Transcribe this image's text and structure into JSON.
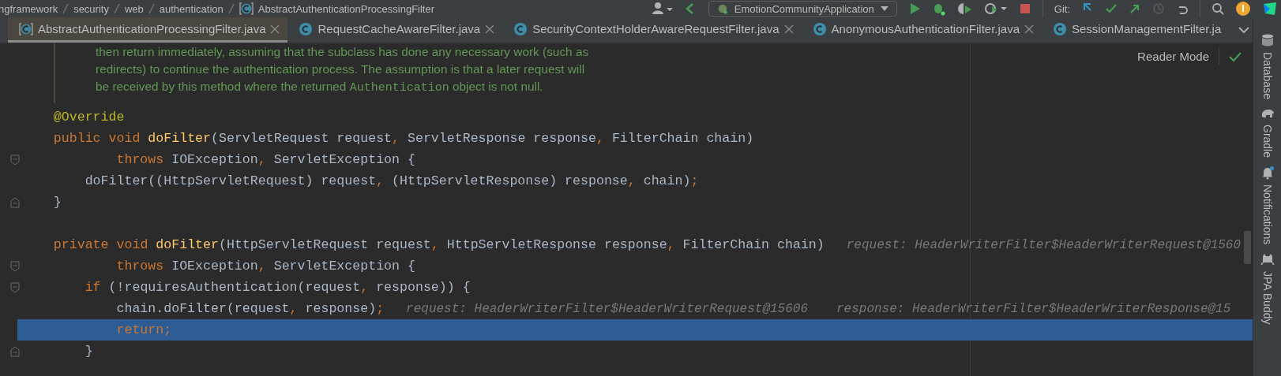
{
  "toolbar": {
    "breadcrumbs": [
      {
        "label": "ngframework",
        "kind": "package"
      },
      {
        "label": "security",
        "kind": "package"
      },
      {
        "label": "web",
        "kind": "package"
      },
      {
        "label": "authentication",
        "kind": "package"
      },
      {
        "label": "AbstractAuthenticationProcessingFilter",
        "kind": "class"
      }
    ],
    "run_config": "EmotionCommunityApplication",
    "git_label": "Git:"
  },
  "tabs": [
    {
      "label": "AbstractAuthenticationProcessingFilter.java",
      "kind": "abstract",
      "selected": true,
      "closable": true
    },
    {
      "label": "RequestCacheAwareFilter.java",
      "kind": "class",
      "selected": false,
      "closable": true
    },
    {
      "label": "SecurityContextHolderAwareRequestFilter.java",
      "kind": "class",
      "selected": false,
      "closable": true
    },
    {
      "label": "AnonymousAuthenticationFilter.java",
      "kind": "class",
      "selected": false,
      "closable": true
    },
    {
      "label": "SessionManagementFilter.ja",
      "kind": "class",
      "selected": false,
      "closable": false
    }
  ],
  "reader_mode": "Reader Mode",
  "doc_comment": [
    [
      {
        "text": "then return immediately, assuming that the subclass has done any necessary work (such as",
        "code": false
      }
    ],
    [
      {
        "text": "redirects) to continue the authentication process. The assumption is that a later request will",
        "code": false
      }
    ],
    [
      {
        "text": "be received by this method where the returned ",
        "code": false
      },
      {
        "text": "Authentication",
        "code": true
      },
      {
        "text": " object is not null.",
        "code": false
      }
    ]
  ],
  "code_lines": [
    {
      "kind": "code",
      "fold_open": false,
      "fold_close": false,
      "current": false,
      "tokens": [
        {
          "text": "    @Override",
          "kind": "ann"
        }
      ]
    },
    {
      "kind": "code",
      "fold_open": false,
      "fold_close": false,
      "current": false,
      "tokens": [
        {
          "text": "    public",
          "kind": "kw"
        },
        {
          "text": " void",
          "kind": "kw"
        },
        {
          "text": " doFilter",
          "kind": "fn"
        },
        {
          "text": "(ServletRequest request",
          "kind": "plain"
        },
        {
          "text": ",",
          "kind": "punc"
        },
        {
          "text": " ServletResponse response",
          "kind": "plain"
        },
        {
          "text": ",",
          "kind": "punc"
        },
        {
          "text": " FilterChain chain)",
          "kind": "plain"
        }
      ]
    },
    {
      "kind": "code",
      "fold_open": true,
      "fold_close": false,
      "current": false,
      "tokens": [
        {
          "text": "            throws",
          "kind": "kw"
        },
        {
          "text": " IOException",
          "kind": "plain"
        },
        {
          "text": ",",
          "kind": "punc"
        },
        {
          "text": " ServletException {",
          "kind": "plain"
        }
      ]
    },
    {
      "kind": "code",
      "fold_open": false,
      "fold_close": false,
      "current": false,
      "tokens": [
        {
          "text": "        doFilter((HttpServletRequest) request",
          "kind": "plain"
        },
        {
          "text": ",",
          "kind": "punc"
        },
        {
          "text": " (HttpServletResponse) response",
          "kind": "plain"
        },
        {
          "text": ",",
          "kind": "punc"
        },
        {
          "text": " chain)",
          "kind": "plain"
        },
        {
          "text": ";",
          "kind": "punc"
        }
      ]
    },
    {
      "kind": "code",
      "fold_open": false,
      "fold_close": true,
      "current": false,
      "tokens": [
        {
          "text": "    }",
          "kind": "plain"
        }
      ]
    },
    {
      "kind": "blank",
      "fold_open": false,
      "fold_close": false,
      "current": false
    },
    {
      "kind": "code",
      "fold_open": false,
      "fold_close": false,
      "current": false,
      "tokens": [
        {
          "text": "    private",
          "kind": "kw"
        },
        {
          "text": " void",
          "kind": "kw"
        },
        {
          "text": " doFilter",
          "kind": "fn"
        },
        {
          "text": "(HttpServletRequest request",
          "kind": "plain"
        },
        {
          "text": ",",
          "kind": "punc"
        },
        {
          "text": " HttpServletResponse response",
          "kind": "plain"
        },
        {
          "text": ",",
          "kind": "punc"
        },
        {
          "text": " FilterChain chain)",
          "kind": "plain"
        }
      ],
      "hints": [
        "request: HeaderWriterFilter$HeaderWriterRequest@1560"
      ]
    },
    {
      "kind": "code",
      "fold_open": true,
      "fold_close": false,
      "current": false,
      "tokens": [
        {
          "text": "            throws",
          "kind": "kw"
        },
        {
          "text": " IOException",
          "kind": "plain"
        },
        {
          "text": ",",
          "kind": "punc"
        },
        {
          "text": " ServletException {",
          "kind": "plain"
        }
      ]
    },
    {
      "kind": "code",
      "fold_open": true,
      "fold_close": false,
      "current": false,
      "tokens": [
        {
          "text": "        if",
          "kind": "kw"
        },
        {
          "text": " (!requiresAuthentication(request",
          "kind": "plain"
        },
        {
          "text": ",",
          "kind": "punc"
        },
        {
          "text": " response)) {",
          "kind": "plain"
        }
      ]
    },
    {
      "kind": "code",
      "fold_open": false,
      "fold_close": false,
      "current": false,
      "tokens": [
        {
          "text": "            chain.doFilter(request",
          "kind": "plain"
        },
        {
          "text": ",",
          "kind": "punc"
        },
        {
          "text": " response)",
          "kind": "plain"
        },
        {
          "text": ";",
          "kind": "punc"
        }
      ],
      "hints": [
        "request: HeaderWriterFilter$HeaderWriterRequest@15606",
        "response: HeaderWriterFilter$HeaderWriterResponse@15"
      ]
    },
    {
      "kind": "code",
      "fold_open": false,
      "fold_close": false,
      "current": true,
      "tokens": [
        {
          "text": "            return",
          "kind": "kw"
        },
        {
          "text": ";",
          "kind": "punc"
        }
      ]
    },
    {
      "kind": "code",
      "fold_open": false,
      "fold_close": true,
      "current": false,
      "tokens": [
        {
          "text": "        }",
          "kind": "plain"
        }
      ]
    }
  ],
  "side_panels": [
    {
      "label": "Database",
      "kind": "database"
    },
    {
      "label": "Gradle",
      "kind": "gradle"
    },
    {
      "label": "Notifications",
      "kind": "bell"
    },
    {
      "label": "JPA Buddy",
      "kind": "buddy"
    }
  ]
}
